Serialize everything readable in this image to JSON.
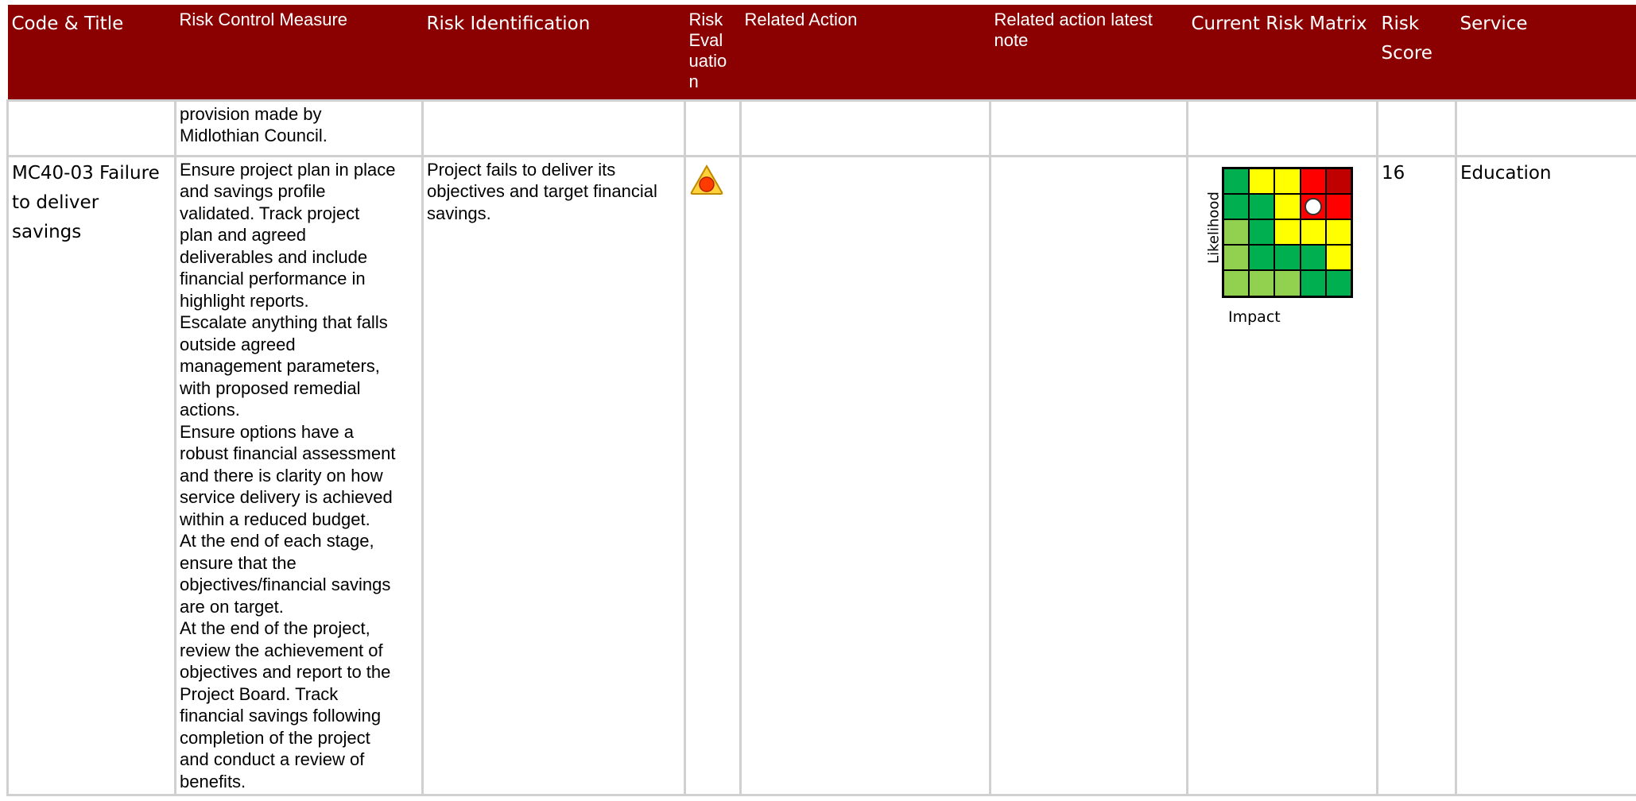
{
  "columns": {
    "code_title": "Code & Title",
    "control_measure": "Risk Control Measure",
    "identification": "Risk Identification",
    "evaluation": [
      "Risk",
      "Eval",
      "uatio",
      "n"
    ],
    "related_action": "Related Action",
    "related_note": "Related action latest note",
    "matrix": "Current Risk Matrix",
    "score": [
      "Risk",
      "Score"
    ],
    "service": "Service"
  },
  "row_continuation": {
    "control_measure": [
      "provision made by",
      "Midlothian Council."
    ]
  },
  "row_main": {
    "code_title": [
      "MC40-03 Failure",
      "to deliver",
      "savings"
    ],
    "control_measure": [
      "Ensure project plan in place",
      "and savings profile",
      "validated. Track project",
      "plan and agreed",
      "deliverables and include",
      "financial performance in",
      "highlight reports.",
      "Escalate anything that falls",
      "outside agreed",
      "management parameters,",
      "with proposed remedial",
      "actions.",
      "Ensure options have a",
      "robust financial assessment",
      "and there is clarity on how",
      "service delivery is achieved",
      "within a reduced budget.",
      "At the end of each stage,",
      "ensure that the",
      "objectives/financial savings",
      "are on target.",
      "At the end of the project,",
      "review the achievement of",
      "objectives and report to the",
      "Project Board. Track",
      "financial savings following",
      "completion of the project",
      "and conduct a review of",
      "benefits."
    ],
    "identification": [
      "Project fails to deliver its",
      "objectives and target financial",
      "savings."
    ],
    "evaluation_icon": "amber-triangle-red-dot-icon",
    "related_action": "",
    "related_note": "",
    "score": "16",
    "service": "Education"
  },
  "risk_matrix": {
    "x_label": "Impact",
    "y_label": "Likelihood",
    "colors": {
      "dark_green": "#00b050",
      "light_green": "#92d050",
      "yellow": "#ffff00",
      "red": "#ff0000",
      "dark_red": "#c00000",
      "header": "#8b0000"
    },
    "grid": [
      [
        "dark_green",
        "yellow",
        "yellow",
        "red",
        "dark_red"
      ],
      [
        "dark_green",
        "dark_green",
        "yellow",
        "red",
        "red"
      ],
      [
        "light_green",
        "dark_green",
        "yellow",
        "yellow",
        "yellow"
      ],
      [
        "light_green",
        "dark_green",
        "dark_green",
        "dark_green",
        "yellow"
      ],
      [
        "light_green",
        "light_green",
        "light_green",
        "dark_green",
        "dark_green"
      ]
    ],
    "marker": {
      "row": 1,
      "col": 3
    }
  }
}
